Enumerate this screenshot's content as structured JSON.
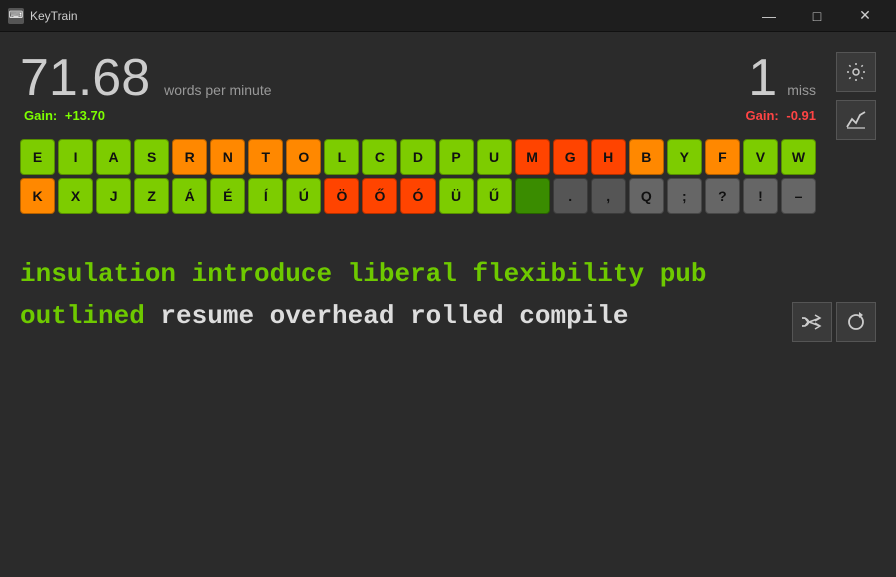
{
  "titlebar": {
    "title": "KeyTrain",
    "icon": "⌨",
    "minimize": "—",
    "maximize": "□",
    "close": "✕"
  },
  "stats": {
    "wpm": "71.68",
    "wpm_label": "words per minute",
    "wpm_gain_label": "Gain:",
    "wpm_gain_value": "+13.70",
    "miss": "1",
    "miss_label": "miss",
    "miss_gain_label": "Gain:",
    "miss_gain_value": "-0.91"
  },
  "buttons": {
    "settings": "⚙",
    "chart": "📈",
    "shuffle": "⇄",
    "refresh": "↺"
  },
  "keys_row1": [
    {
      "label": "E",
      "color": "#7dcc00"
    },
    {
      "label": "I",
      "color": "#7dcc00"
    },
    {
      "label": "A",
      "color": "#7dcc00"
    },
    {
      "label": "S",
      "color": "#7dcc00"
    },
    {
      "label": "R",
      "color": "#ff8800"
    },
    {
      "label": "N",
      "color": "#ff8800"
    },
    {
      "label": "T",
      "color": "#ff8800"
    },
    {
      "label": "O",
      "color": "#ff8800"
    },
    {
      "label": "L",
      "color": "#7dcc00"
    },
    {
      "label": "C",
      "color": "#7dcc00"
    },
    {
      "label": "D",
      "color": "#7dcc00"
    },
    {
      "label": "P",
      "color": "#7dcc00"
    },
    {
      "label": "U",
      "color": "#7dcc00"
    },
    {
      "label": "M",
      "color": "#ff4400"
    },
    {
      "label": "G",
      "color": "#ff4400"
    },
    {
      "label": "H",
      "color": "#ff4400"
    },
    {
      "label": "B",
      "color": "#ff8800"
    },
    {
      "label": "Y",
      "color": "#7dcc00"
    },
    {
      "label": "F",
      "color": "#ff8800"
    },
    {
      "label": "V",
      "color": "#7dcc00"
    },
    {
      "label": "W",
      "color": "#7dcc00"
    }
  ],
  "keys_row2": [
    {
      "label": "K",
      "color": "#ff8800"
    },
    {
      "label": "X",
      "color": "#7dcc00"
    },
    {
      "label": "J",
      "color": "#7dcc00"
    },
    {
      "label": "Z",
      "color": "#7dcc00"
    },
    {
      "label": "Á",
      "color": "#7dcc00"
    },
    {
      "label": "É",
      "color": "#7dcc00"
    },
    {
      "label": "Í",
      "color": "#7dcc00"
    },
    {
      "label": "Ú",
      "color": "#7dcc00"
    },
    {
      "label": "Ö",
      "color": "#ff4400"
    },
    {
      "label": "Ő",
      "color": "#ff4400"
    },
    {
      "label": "Ó",
      "color": "#ff4400"
    },
    {
      "label": "Ü",
      "color": "#7dcc00"
    },
    {
      "label": "Ű",
      "color": "#7dcc00"
    },
    {
      "label": " ",
      "color": "#3a8c00"
    },
    {
      "label": ".",
      "color": "#555555"
    },
    {
      "label": ",",
      "color": "#555555"
    },
    {
      "label": "Q",
      "color": "#666666"
    },
    {
      "label": ";",
      "color": "#666666"
    },
    {
      "label": "?",
      "color": "#666666"
    },
    {
      "label": "!",
      "color": "#666666"
    },
    {
      "label": "–",
      "color": "#666666"
    }
  ],
  "typing": {
    "typed": "insulation introduce liberal flexibility pub\noutlined",
    "pending": " resume overhead rolled compile"
  }
}
